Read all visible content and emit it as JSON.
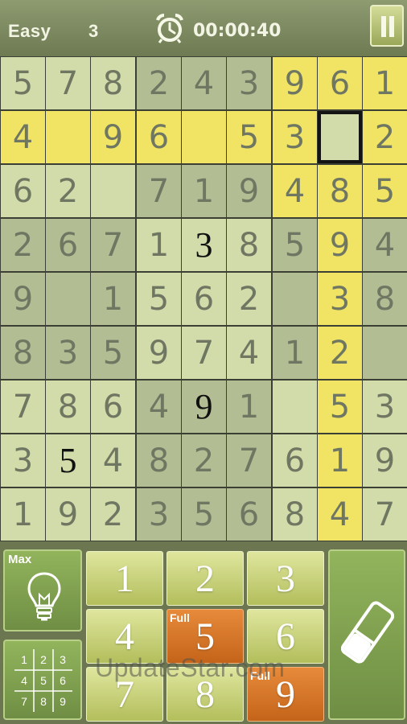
{
  "header": {
    "difficulty": "Easy",
    "puzzle_number": "3",
    "timer": "00:00:40",
    "clock_icon": "alarm-clock-icon",
    "pause_icon": "pause-icon"
  },
  "board": {
    "rows": [
      [
        "5",
        "7",
        "8",
        "2",
        "4",
        "3",
        "9",
        "6",
        "1"
      ],
      [
        "4",
        "",
        "9",
        "6",
        "",
        "5",
        "3",
        "",
        "2"
      ],
      [
        "6",
        "2",
        "",
        "7",
        "1",
        "9",
        "4",
        "8",
        "5"
      ],
      [
        "2",
        "6",
        "7",
        "1",
        "3",
        "8",
        "5",
        "9",
        "4"
      ],
      [
        "9",
        "",
        "1",
        "5",
        "6",
        "2",
        "",
        "3",
        "8"
      ],
      [
        "8",
        "3",
        "5",
        "9",
        "7",
        "4",
        "1",
        "2",
        ""
      ],
      [
        "7",
        "8",
        "6",
        "4",
        "9",
        "1",
        "",
        "5",
        "3"
      ],
      [
        "3",
        "5",
        "4",
        "8",
        "2",
        "7",
        "6",
        "1",
        "9"
      ],
      [
        "1",
        "9",
        "2",
        "3",
        "5",
        "6",
        "8",
        "4",
        "7"
      ]
    ],
    "given_cells": [
      [
        3,
        4
      ],
      [
        6,
        4
      ],
      [
        7,
        1
      ]
    ],
    "selected_cell": [
      1,
      7
    ],
    "highlight_color": "#f1e465"
  },
  "controls": {
    "hint": {
      "label": "Max",
      "icon": "lightbulb-icon"
    },
    "notes": {
      "icon": "pencil-marks-grid-icon",
      "digits": [
        "1",
        "2",
        "3",
        "4",
        "5",
        "6",
        "7",
        "8",
        "9"
      ]
    },
    "numbers": [
      {
        "label": "1",
        "full": false,
        "full_label": ""
      },
      {
        "label": "2",
        "full": false,
        "full_label": ""
      },
      {
        "label": "3",
        "full": false,
        "full_label": ""
      },
      {
        "label": "4",
        "full": false,
        "full_label": ""
      },
      {
        "label": "5",
        "full": true,
        "full_label": "Full"
      },
      {
        "label": "6",
        "full": false,
        "full_label": ""
      },
      {
        "label": "7",
        "full": false,
        "full_label": ""
      },
      {
        "label": "8",
        "full": false,
        "full_label": ""
      },
      {
        "label": "9",
        "full": true,
        "full_label": "Full"
      }
    ],
    "erase": {
      "icon": "eraser-icon"
    },
    "full_color": "#d8772a"
  },
  "watermark": "UpdateStar.com"
}
